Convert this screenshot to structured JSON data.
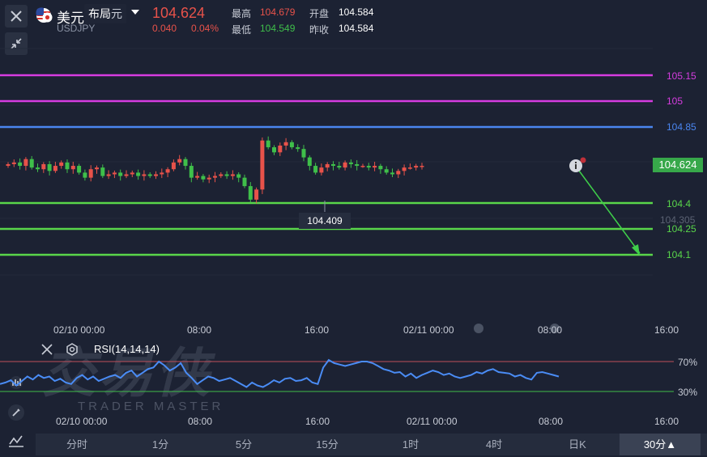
{
  "header": {
    "instrument_name": "美元",
    "instrument_code": "USDJPY",
    "layout_dropdown": "布局",
    "layout_dropdown_suffix": "元",
    "price": "104.624",
    "change": "0.040",
    "change_pct": "0.04%",
    "high_label": "最高",
    "high_value": "104.679",
    "low_label": "最低",
    "low_value": "104.549",
    "open_label": "开盘",
    "open_value": "104.584",
    "prev_close_label": "昨收",
    "prev_close_value": "104.584"
  },
  "price_levels": [
    {
      "label": "105.15",
      "color": "#d63ce0"
    },
    {
      "label": "105",
      "color": "#d63ce0"
    },
    {
      "label": "104.85",
      "color": "#4a86f0"
    },
    {
      "label": "104.4",
      "color": "#59d64a"
    },
    {
      "label": "104.305"
    },
    {
      "label": "104.25",
      "color": "#59d64a"
    },
    {
      "label": "104.1",
      "color": "#59d64a"
    }
  ],
  "current_price_tag": {
    "label": "104.624",
    "color": "#37a84a"
  },
  "low_annotation": "104.409",
  "main_time_axis": [
    "02/10 00:00",
    "08:00",
    "16:00",
    "02/11 00:00",
    "08:00",
    "16:00"
  ],
  "rsi": {
    "title": "RSI(14,14,14)",
    "levels": [
      "70%",
      "30%"
    ],
    "time_axis": [
      "02/10 00:00",
      "08:00",
      "16:00",
      "02/11 00:00",
      "08:00",
      "16:00"
    ]
  },
  "watermark": {
    "brand": "交易侠",
    "sub": "TRADER MASTER"
  },
  "timeframes": [
    "分时",
    "1分",
    "5分",
    "15分",
    "1时",
    "4时",
    "日K",
    "30分▲"
  ],
  "active_timeframe": "30分▲",
  "colors": {
    "up": "#e8524a",
    "down": "#3fbf4a",
    "background": "#1c2233"
  }
}
